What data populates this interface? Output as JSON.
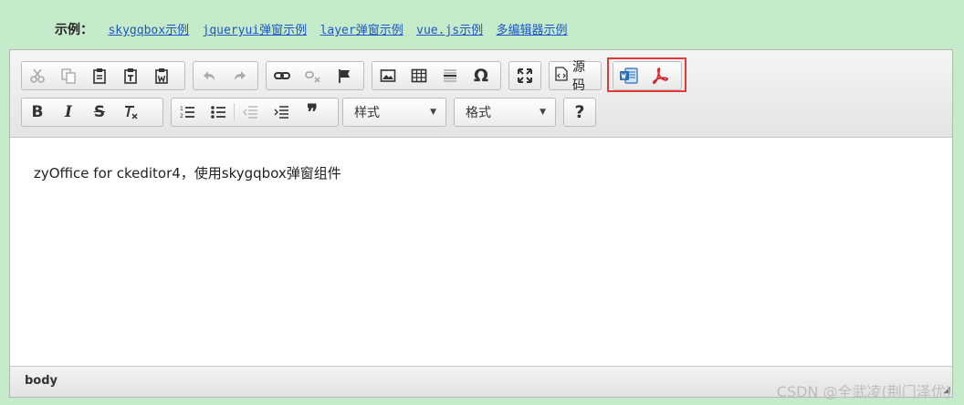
{
  "examples": {
    "label": "示例：",
    "links": [
      "skygqbox示例",
      "jqueryui弹窗示例",
      "layer弹窗示例",
      "vue.js示例",
      "多编辑器示例"
    ]
  },
  "toolbar": {
    "source_label": "源码",
    "style_combo": "样式",
    "format_combo": "格式",
    "special_char": "Ω",
    "help": "?"
  },
  "content": {
    "text": "zyOffice for ckeditor4，使用skygqbox弹窗组件"
  },
  "statusbar": {
    "path": "body"
  },
  "watermark": "CSDN @全武凌(荆门泽优)",
  "colors": {
    "accent": "#e53935",
    "background": "#c6ebcb",
    "link": "#1a55c8"
  }
}
